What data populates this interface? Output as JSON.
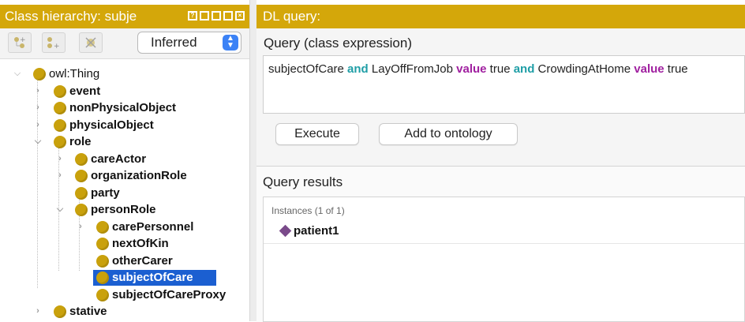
{
  "left_panel": {
    "title": "Class hierarchy: subje",
    "title_color": "#d4a70a",
    "view_mode": "Inferred",
    "tree": [
      {
        "label": "owl:Thing",
        "expanded": true
      },
      {
        "label": "event"
      },
      {
        "label": "nonPhysicalObject"
      },
      {
        "label": "physicalObject"
      },
      {
        "label": "role",
        "expanded": true
      },
      {
        "label": "careActor"
      },
      {
        "label": "organizationRole"
      },
      {
        "label": "party"
      },
      {
        "label": "personRole",
        "expanded": true
      },
      {
        "label": "carePersonnel"
      },
      {
        "label": "nextOfKin"
      },
      {
        "label": "otherCarer"
      },
      {
        "label": "subjectOfCare",
        "selected": true
      },
      {
        "label": "subjectOfCareProxy"
      },
      {
        "label": "stative"
      }
    ],
    "selection_color": "#1b5fd1",
    "class_dot_color": "#c9a10c"
  },
  "right_panel": {
    "title": "DL query:",
    "query_label": "Query (class expression)",
    "query": {
      "p1": "subjectOfCare ",
      "and1": "and",
      "p2": " LayOffFromJob ",
      "value1": "value",
      "p3": " true ",
      "and2": "and",
      "p4": " CrowdingAtHome ",
      "value2": "value",
      "p5": " true"
    },
    "execute_label": "Execute",
    "add_label": "Add to ontology",
    "results_label": "Query results",
    "instances_label": "Instances (1 of 1)",
    "instances": [
      "patient1"
    ],
    "keyword_and_color": "#1f9ea6",
    "keyword_value_color": "#a020a0"
  }
}
